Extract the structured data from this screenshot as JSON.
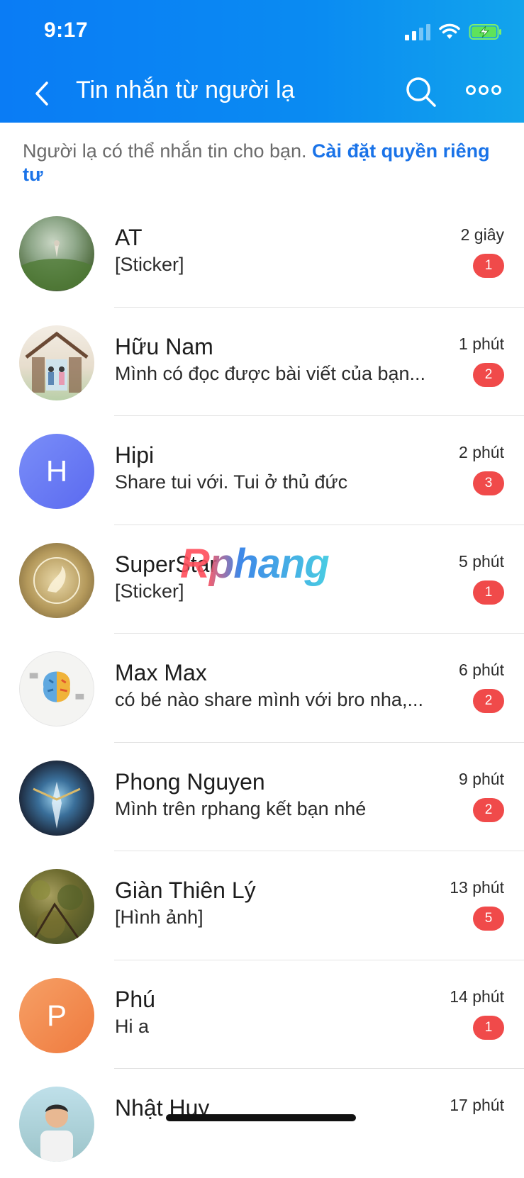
{
  "status_bar": {
    "time": "9:17"
  },
  "header": {
    "title": "Tin nhắn từ người lạ"
  },
  "notice": {
    "text": "Người lạ có thể nhắn tin cho bạn. ",
    "link": "Cài đặt quyền riêng tư"
  },
  "conversations": [
    {
      "name": "AT",
      "preview": "[Sticker]",
      "time": "2 giây",
      "unread": "1"
    },
    {
      "name": "Hữu Nam",
      "preview": "Mình có đọc được bài viết của bạn...",
      "time": "1 phút",
      "unread": "2"
    },
    {
      "name": "Hipi",
      "preview": "Share tui với. Tui ở thủ đức",
      "time": "2 phút",
      "unread": "3",
      "initial": "H",
      "avatar_color": "#6b7ff5"
    },
    {
      "name": "SuperStar",
      "preview": "[Sticker]",
      "time": "5 phút",
      "unread": "1"
    },
    {
      "name": "Max Max",
      "preview": "có bé nào share mình với bro nha,...",
      "time": "6 phút",
      "unread": "2"
    },
    {
      "name": "Phong Nguyen",
      "preview": "Mình trên rphang kết bạn nhé",
      "time": "9 phút",
      "unread": "2"
    },
    {
      "name": "Giàn Thiên Lý",
      "preview": "[Hình ảnh]",
      "time": "13 phút",
      "unread": "5"
    },
    {
      "name": "Phú",
      "preview": "Hi a",
      "time": "14 phút",
      "unread": "1",
      "initial": "P",
      "avatar_color": "#f0804a"
    },
    {
      "name": "Nhật Huy",
      "preview": "",
      "time": "17 phút",
      "unread": ""
    }
  ],
  "watermark": "Rphang",
  "colors": {
    "header": "#0a86f3",
    "badge": "#f04a4a",
    "link": "#1a73e8"
  }
}
